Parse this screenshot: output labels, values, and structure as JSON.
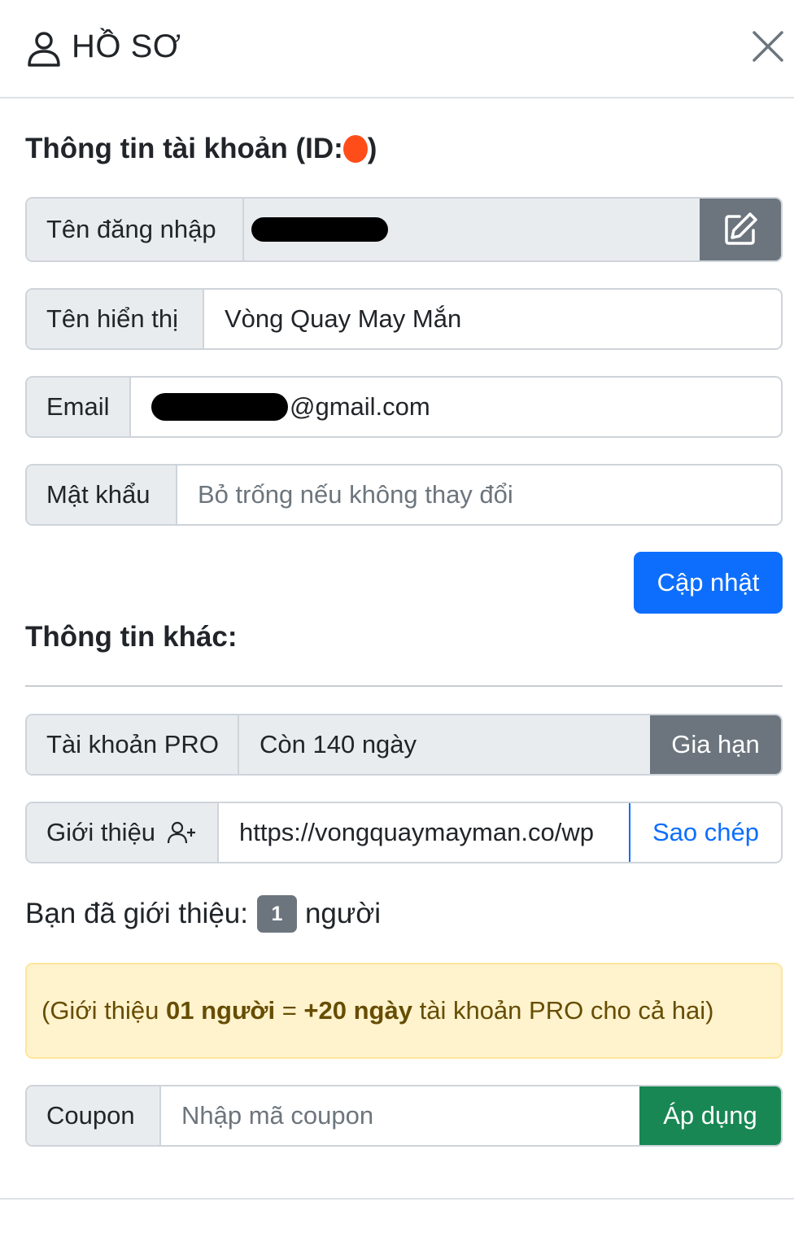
{
  "header": {
    "title": "HỒ SƠ",
    "user_icon": "person-icon",
    "close_icon": "close-icon"
  },
  "account": {
    "title": "Thông tin tài khoản (ID:",
    "title_close": ")",
    "username_label": "Tên đăng nhập",
    "edit_icon": "edit-icon",
    "display_name_label": "Tên hiển thị",
    "display_name_value": "Vòng Quay May Mắn",
    "email_label": "Email",
    "email_suffix": "@gmail.com",
    "password_label": "Mật khẩu",
    "password_placeholder": "Bỏ trống nếu không thay đổi",
    "update_button": "Cập nhật"
  },
  "other": {
    "title": "Thông tin khác:",
    "pro_label": "Tài khoản PRO",
    "pro_value": "Còn 140 ngày",
    "renew_button": "Gia hạn",
    "referral_label": "Giới thiệu",
    "referral_icon": "user-plus-icon",
    "referral_link": "https://vongquaymayman.co/wp",
    "copy_button": "Sao chép",
    "referred_prefix": "Bạn đã giới thiệu:",
    "referred_count": "1",
    "referred_suffix": "người",
    "promo_open": "(Giới thiệu ",
    "promo_bold1": "01 người",
    "promo_mid": " = ",
    "promo_bold2": "+20 ngày",
    "promo_close": " tài khoản PRO cho cả hai)",
    "coupon_label": "Coupon",
    "coupon_placeholder": "Nhập mã coupon",
    "apply_button": "Áp dụng"
  },
  "colors": {
    "primary": "#0d6efd",
    "secondary": "#6c757d",
    "success": "#198754",
    "warning_bg": "#fff3cd",
    "redaction_dot": "#ff4d1a"
  }
}
